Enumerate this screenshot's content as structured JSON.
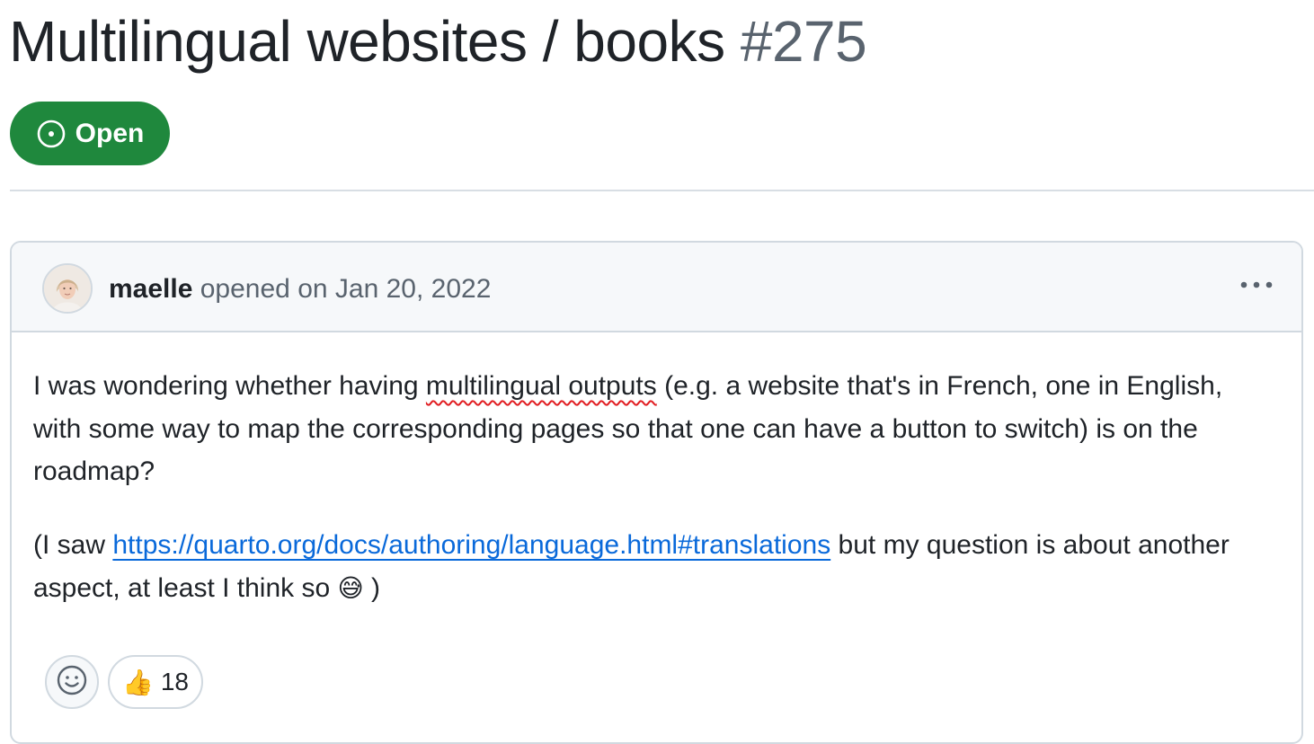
{
  "issue": {
    "title": "Multilingual websites / books",
    "number": "#275",
    "state_label": "Open",
    "state_icon": "issue-opened-icon",
    "state_color": "#1f883d"
  },
  "comment": {
    "author": "maelle",
    "action_text": "opened on Jan 20, 2022",
    "more_icon": "kebab-horizontal-icon",
    "body": {
      "p1_before": "I was wondering whether having ",
      "p1_misspelled": "multilingual outputs",
      "p1_after": " (e.g. a website that's in French, one in English, with some way to map the corresponding pages so that one can have a button to switch) is on the roadmap?",
      "p2_before": "(I saw ",
      "p2_link": "https://quarto.org/docs/authoring/language.html#translations",
      "p2_after": " but my question is about another aspect, at least I think so ",
      "p2_emoji": "😅",
      "p2_end": " )"
    },
    "reactions": {
      "add_icon": "smiley-icon",
      "thumbs_emoji": "👍",
      "thumbs_count": "18"
    }
  },
  "colors": {
    "link": "#0969da",
    "muted": "#59636e",
    "border": "#d1d9e0",
    "spellcheck": "#e11d21"
  }
}
